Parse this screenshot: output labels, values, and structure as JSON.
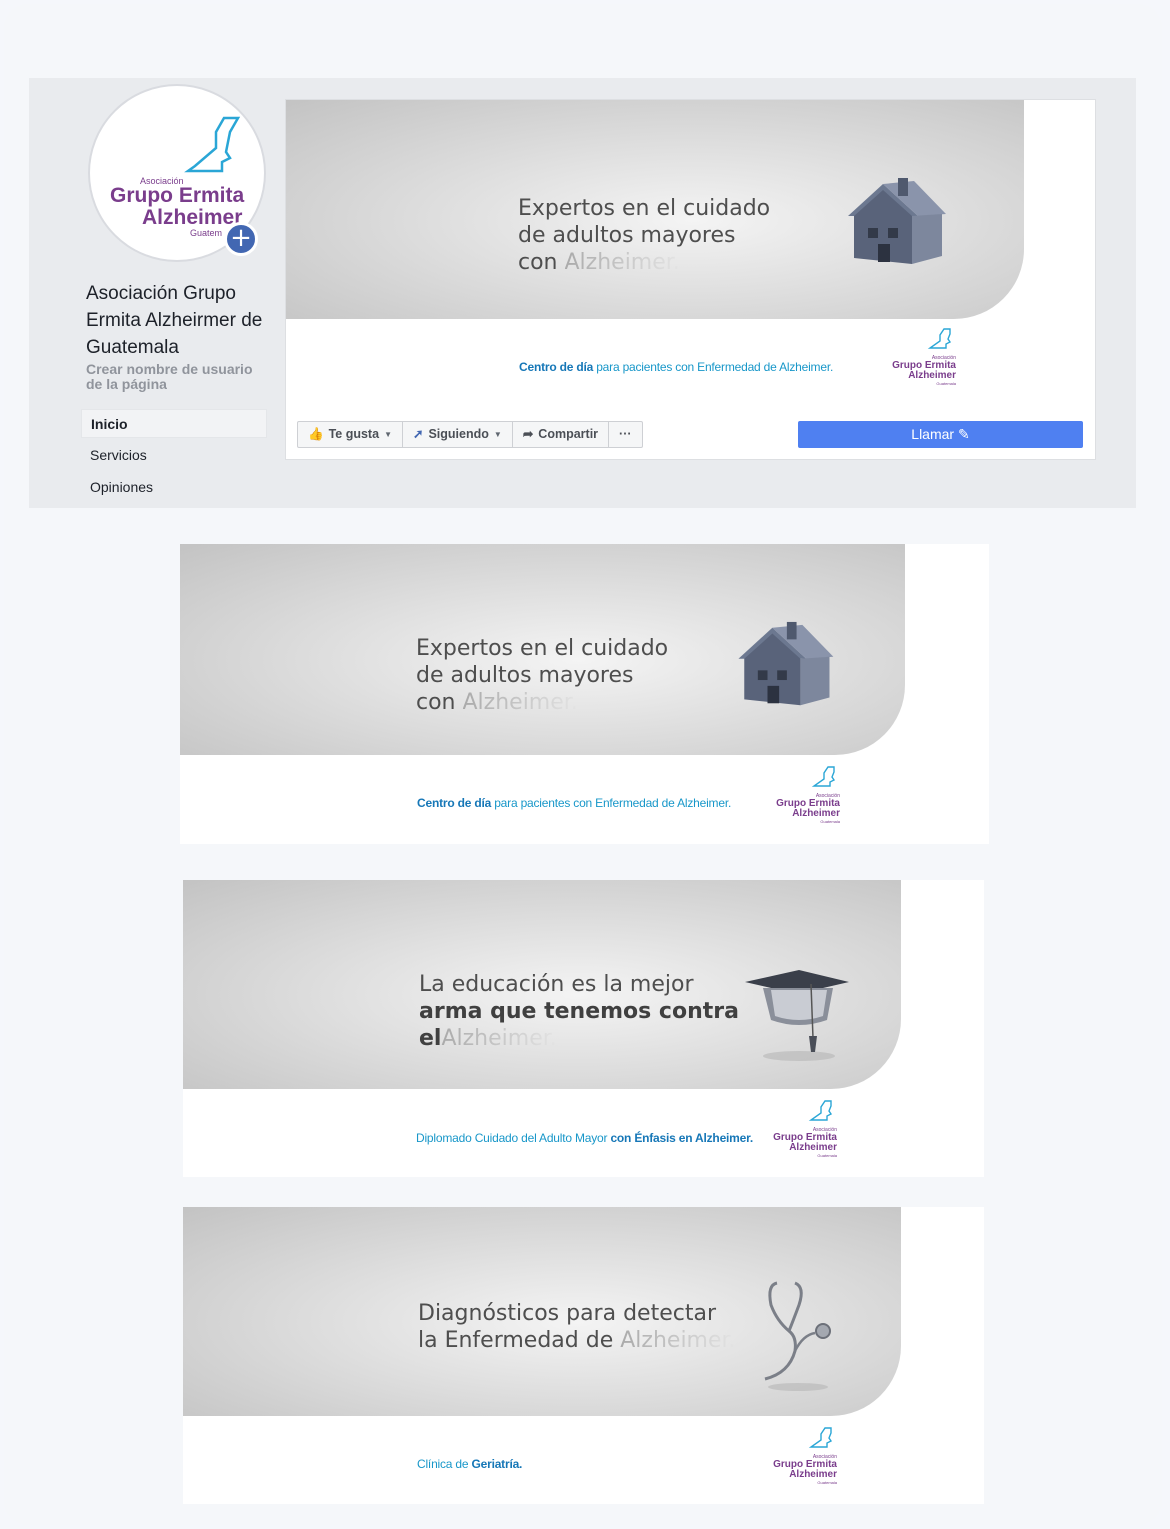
{
  "fb_page": {
    "page_name": "Asociación Grupo Ermita Alzheirmer de Guatemala",
    "username_prompt": "Crear nombre de usuario de la página",
    "nav": [
      "Inicio",
      "Servicios",
      "Opiniones"
    ],
    "actions": {
      "like": "Te gusta",
      "following": "Siguiendo",
      "share": "Compartir",
      "more": "···"
    },
    "call_button": "Llamar"
  },
  "logo": {
    "small": "Asociación",
    "line1": "Grupo Ermita",
    "line2": "Alzheimer",
    "country": "Guatemala",
    "country_partial": "Guatem"
  },
  "banners": [
    {
      "line1": "Expertos en el cuidado",
      "line2": "de adultos mayores",
      "line3_prefix": "con",
      "faded": "Alzheimer.",
      "tag_bold": "Centro de día",
      "tag_rest": " para pacientes con Enfermedad de Alzheimer.",
      "icon": "house-icon"
    },
    {
      "line1": "La educación es la mejor",
      "line2": "arma que tenemos contra",
      "line3_prefix": "el",
      "faded": "Alzheimer.",
      "tag_plain": "Diplomado Cuidado del Adulto Mayor ",
      "tag_bold": "con Énfasis en Alzheimer.",
      "icon": "graduation-cap-icon"
    },
    {
      "line1": "Diagnósticos para detectar",
      "line2_prefix": "la Enfermedad de",
      "faded": "Alzheimer.",
      "tag_plain": "Clínica de ",
      "tag_bold": "Geriatría.",
      "icon": "stethoscope-icon"
    }
  ],
  "colors": {
    "fb_blue": "#4267b2",
    "call_blue": "#4f80f1",
    "logo_purple": "#7a3d8c",
    "logo_cyan": "#2aa6d6",
    "tag_blue": "#1897c9"
  }
}
